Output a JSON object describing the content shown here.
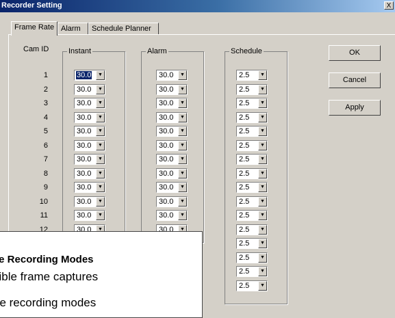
{
  "window": {
    "title": "Recorder Setting",
    "close_glyph": "X"
  },
  "tabs": [
    {
      "label": "Frame Rate",
      "active": true
    },
    {
      "label": "Alarm",
      "active": false
    },
    {
      "label": "Schedule Planner",
      "active": false
    }
  ],
  "columns": {
    "cam_id": "Cam ID",
    "instant": "Instant",
    "alarm": "Alarm",
    "schedule": "Schedule"
  },
  "cameras": [
    "1",
    "2",
    "3",
    "4",
    "5",
    "6",
    "7",
    "8",
    "9",
    "10",
    "11",
    "12"
  ],
  "instant_values": [
    "30.0",
    "30.0",
    "30.0",
    "30.0",
    "30.0",
    "30.0",
    "30.0",
    "30.0",
    "30.0",
    "30.0",
    "30.0",
    "30.0"
  ],
  "alarm_values": [
    "30.0",
    "30.0",
    "30.0",
    "30.0",
    "30.0",
    "30.0",
    "30.0",
    "30.0",
    "30.0",
    "30.0",
    "30.0",
    "30.0"
  ],
  "schedule_values": [
    "2.5",
    "2.5",
    "2.5",
    "2.5",
    "2.5",
    "2.5",
    "2.5",
    "2.5",
    "2.5",
    "2.5",
    "2.5",
    "2.5",
    "2.5",
    "2.5",
    "2.5",
    "2.5"
  ],
  "buttons": {
    "ok": "OK",
    "cancel": "Cancel",
    "apply": "Apply"
  },
  "overlay": {
    "title": "le Recording Modes",
    "line1": "xible frame captures",
    "line2": "ee recording modes"
  },
  "icons": {
    "dropdown": "chevron-down-icon",
    "close": "close-icon"
  }
}
